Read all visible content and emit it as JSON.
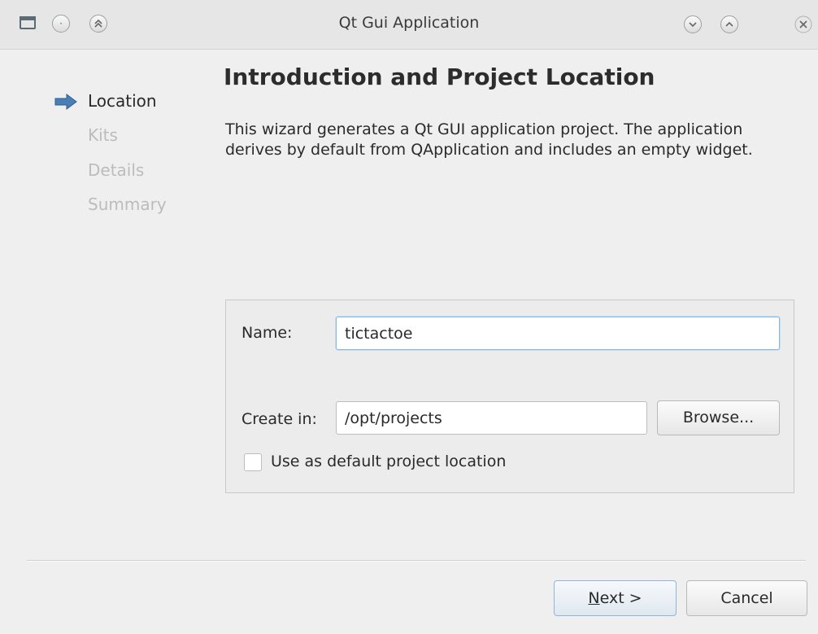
{
  "window": {
    "title": "Qt Gui Application"
  },
  "titlebar_icons": {
    "menu": "circle-dot-icon",
    "shade": "double-chevron-up-icon",
    "minimize": "chevron-down-icon",
    "maximize": "chevron-up-icon",
    "close": "close-icon"
  },
  "steps": [
    {
      "label": "Location",
      "active": true
    },
    {
      "label": "Kits",
      "active": false
    },
    {
      "label": "Details",
      "active": false
    },
    {
      "label": "Summary",
      "active": false
    }
  ],
  "page": {
    "heading": "Introduction and Project Location",
    "description": "This wizard generates a Qt GUI application project. The application derives by default from QApplication and includes an empty widget."
  },
  "form": {
    "name_label": "Name:",
    "name_value": "tictactoe",
    "create_in_label": "Create in:",
    "create_in_value": "/opt/projects",
    "browse_label": "Browse...",
    "default_location_label": "Use as default project location",
    "default_location_checked": false
  },
  "buttons": {
    "next_mnemonic": "N",
    "next_rest": "ext >",
    "cancel": "Cancel"
  },
  "colors": {
    "accent": "#4a7fb5",
    "window_bg": "#efefef",
    "disabled_text": "#bcbcbc"
  }
}
